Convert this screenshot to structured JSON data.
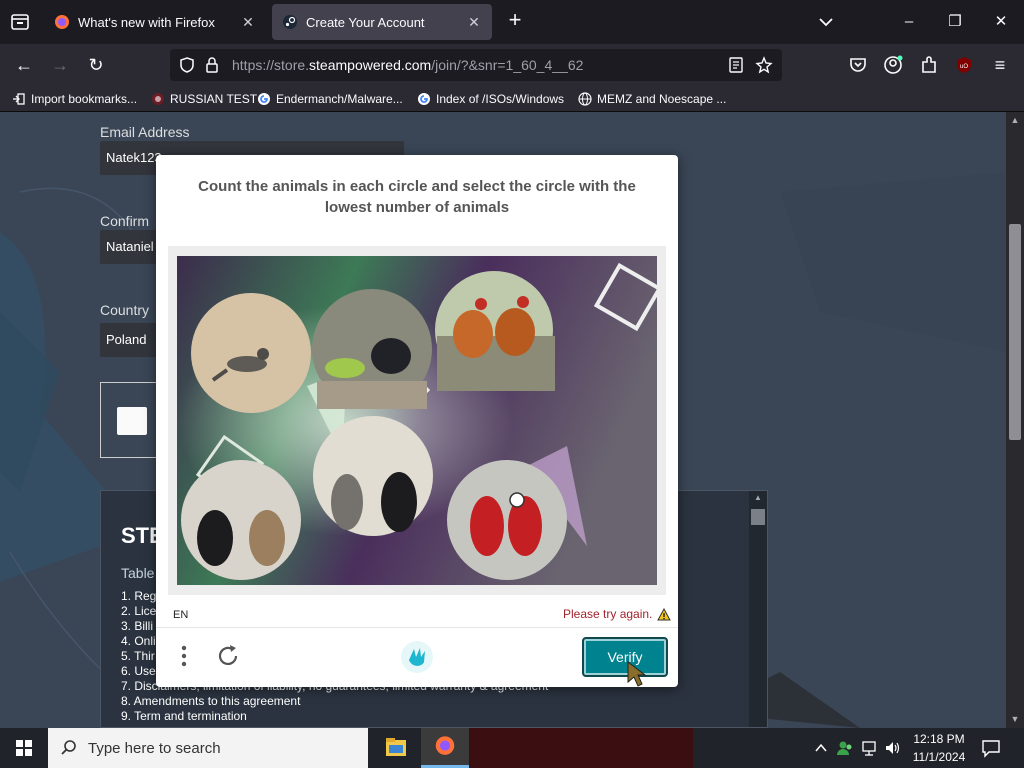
{
  "browser": {
    "tabs": [
      {
        "title": "What's new with Firefox",
        "active": false
      },
      {
        "title": "Create Your Account",
        "active": true
      }
    ],
    "url": {
      "prefix": "https://store.",
      "domain": "steampowered.com",
      "path": "/join/?&snr=1_60_4__62"
    },
    "bookmarks": [
      {
        "label": "Import bookmarks...",
        "icon": "import-icon"
      },
      {
        "label": "RUSSIAN TEST",
        "icon": "site-icon"
      },
      {
        "label": "Endermanch/Malware...",
        "icon": "google-icon"
      },
      {
        "label": "Index of /ISOs/Windows",
        "icon": "google-icon"
      },
      {
        "label": "MEMZ and Noescape ...",
        "icon": "globe-icon"
      }
    ]
  },
  "form": {
    "email_label": "Email Address",
    "email_value": "Natek123",
    "confirm_label": "Confirm",
    "confirm_value": "Nataniel",
    "country_label": "Country",
    "country_value": "Poland"
  },
  "terms": {
    "title": "STE",
    "subtitle": "Table",
    "items": [
      "1. Reg",
      "2. Lice",
      "3. Billi",
      "4. Onli",
      "5. Thir",
      "6. Use",
      "7. Disclaimers, limitation of liability, no guarantees, limited warranty & agreement",
      "8. Amendments to this agreement",
      "9. Term and termination"
    ]
  },
  "captcha": {
    "prompt": "Count the animals in each circle and select the circle with the lowest number of animals",
    "language": "EN",
    "error": "Please try again.",
    "verify_label": "Verify"
  },
  "taskbar": {
    "search_placeholder": "Type here to search",
    "time": "12:18 PM",
    "date": "11/1/2024"
  },
  "colors": {
    "verify": "#00838f",
    "error": "#a4242c",
    "page_bg": "#3a4656"
  }
}
